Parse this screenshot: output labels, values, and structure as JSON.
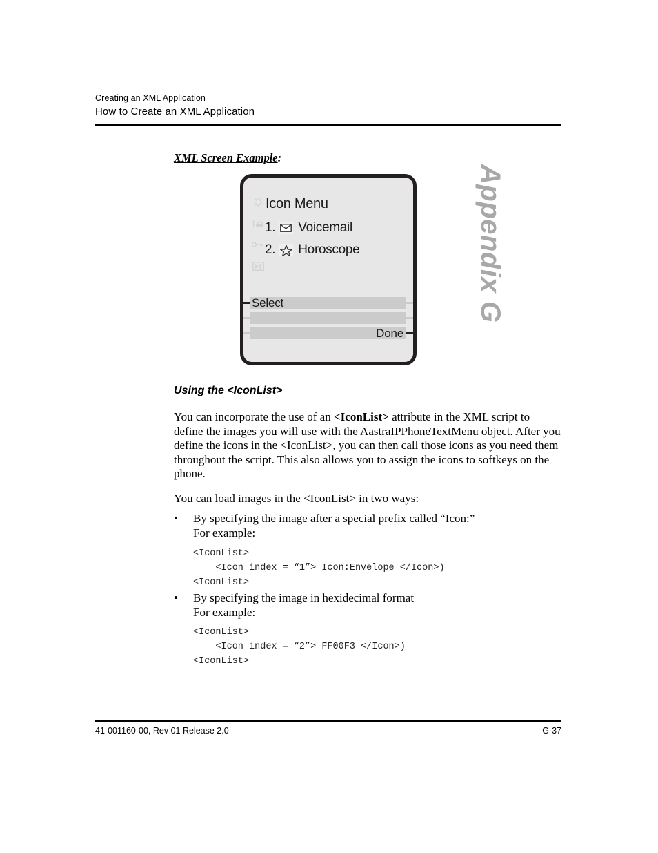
{
  "document": {
    "header": {
      "chapter_title": "Creating an XML Application",
      "section_title": "How to Create an XML Application"
    },
    "side_tab": "Appendix G",
    "footer": {
      "left": "41-001160-00, Rev 01  Release 2.0",
      "page_number": "G-37"
    }
  },
  "section_label": {
    "underlined": "XML Screen Example",
    "colon": ":"
  },
  "phone_screen": {
    "title": "Icon Menu",
    "rail_icons": [
      "asterisk-icon",
      "phone-handset-icon",
      "key-icon",
      "navigation-marker-icon"
    ],
    "menu_items": [
      {
        "number": "1.",
        "icon": "envelope-icon",
        "label": "Voicemail"
      },
      {
        "number": "2.",
        "icon": "star-icon",
        "label": "Horoscope"
      }
    ],
    "softkeys": [
      {
        "left_label": "Select",
        "right_label": ""
      },
      {
        "left_label": "",
        "right_label": ""
      },
      {
        "left_label": "",
        "right_label": "Done"
      }
    ],
    "colors": {
      "screen_background": "#e7e7e7",
      "border": "#231f20",
      "softkey_bar": "#cbcbcb",
      "rail_icon": "#d3d3d3"
    }
  },
  "body": {
    "sub_heading": "Using the <IconList>",
    "paragraph_1": {
      "part_1": "You can incorporate the use of an ",
      "bold_1": "<IconList>",
      "part_2": " attribute in the XML script to define the images you will use with the AastraIPPhoneTextMenu object. After you define the icons in the <IconList>, you can then call those icons as you need them throughout the script. This also allows you to assign the icons to softkeys on the phone."
    },
    "paragraph_2": "You can load images in the <IconList> in two ways:",
    "bullets": [
      {
        "marker": "•",
        "line_1": "By specifying the image after a special prefix called “Icon:”",
        "line_2": "For example:",
        "code": "<IconList>\n    <Icon index = “1”> Icon:Envelope </Icon>)\n<IconList>"
      },
      {
        "marker": "•",
        "line_1": "By specifying the image in hexidecimal format",
        "line_2": "For example:",
        "code": "<IconList>\n    <Icon index = “2”> FF00F3 </Icon>)\n<IconList>"
      }
    ]
  }
}
